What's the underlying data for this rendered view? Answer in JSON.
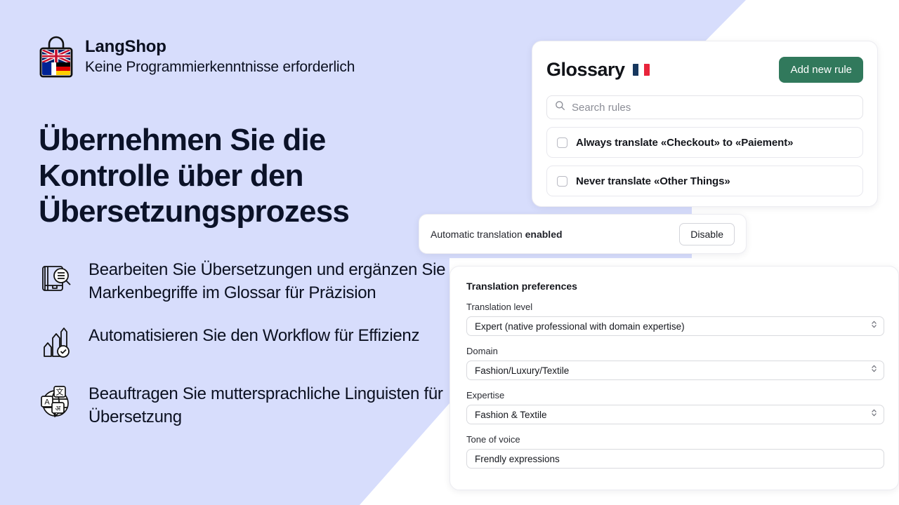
{
  "colors": {
    "background_lavender": "#d7ddfc",
    "page_white": "#ffffff",
    "heading_navy": "#0b1228",
    "accent_green": "#31795c",
    "card_border": "#ececf1"
  },
  "hero": {
    "brand_name": "LangShop",
    "brand_tagline": "Keine Programmierkenntnisse erforderlich",
    "logo_icon": "shopping-bag-flags-icon",
    "headline": "Übernehmen Sie die Kontrolle über den Übersetzungsprozess",
    "features": [
      {
        "icon": "book-magnifier-icon",
        "text": "Bearbeiten Sie Übersetzungen und ergänzen Sie Markenbegriffe im Glossar für Präzision"
      },
      {
        "icon": "growth-arrows-check-icon",
        "text": "Automatisieren Sie den Workflow für Effizienz"
      },
      {
        "icon": "globe-translate-icon",
        "text": "Beauftragen Sie muttersprachliche Linguisten für Übersetzung"
      }
    ]
  },
  "glossary": {
    "title": "Glossary",
    "flag_icon": "flag-france-icon",
    "add_rule_label": "Add new rule",
    "search": {
      "icon": "search-icon",
      "placeholder": "Search rules",
      "value": ""
    },
    "rules": [
      {
        "label": "Always translate «Checkout» to «Paiement»",
        "checked": false
      },
      {
        "label": "Never translate «Other Things»",
        "checked": false
      }
    ]
  },
  "auto_translation": {
    "text_prefix": "Automatic translation ",
    "status": "enabled",
    "button_label": "Disable"
  },
  "preferences": {
    "title": "Translation preferences",
    "fields": [
      {
        "label": "Translation level",
        "value": "Expert (native professional with domain expertise)",
        "control": "select"
      },
      {
        "label": "Domain",
        "value": "Fashion/Luxury/Textile",
        "control": "select"
      },
      {
        "label": "Expertise",
        "value": "Fashion & Textile",
        "control": "select"
      },
      {
        "label": "Tone of voice",
        "value": "Frendly expressions",
        "control": "text"
      }
    ]
  }
}
